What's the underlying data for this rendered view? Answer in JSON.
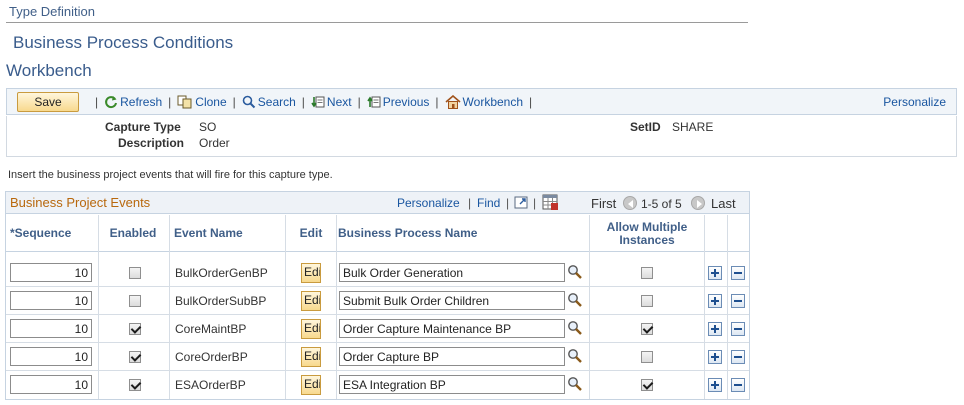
{
  "header": {
    "type_definition": "Type Definition",
    "title": "Business Process Conditions",
    "subtitle": "Workbench"
  },
  "toolbar": {
    "save_label": "Save",
    "refresh_label": "Refresh",
    "clone_label": "Clone",
    "search_label": "Search",
    "next_label": "Next",
    "previous_label": "Previous",
    "workbench_label": "Workbench",
    "separator": "|",
    "personalize_label": "Personalize"
  },
  "info": {
    "capture_type_label": "Capture Type",
    "capture_type_value": "SO",
    "description_label": "Description",
    "description_value": "Order",
    "setid_label": "SetID",
    "setid_value": "SHARE"
  },
  "instruction": "Insert the business project events that will fire for this capture type.",
  "grid": {
    "title": "Business Project Events",
    "personalize_label": "Personalize",
    "find_label": "Find",
    "first_label": "First",
    "range_label": "1-5 of 5",
    "last_label": "Last",
    "separator": "|",
    "columns": {
      "sequence": "*Sequence",
      "enabled": "Enabled",
      "event_name": "Event Name",
      "edit": "Edit",
      "bp_name": "Business Process Name",
      "allow_multiple": "Allow Multiple Instances"
    },
    "rows": [
      {
        "sequence": "10",
        "enabled": false,
        "event_name": "BulkOrderGenBP",
        "edit_label": "Edit",
        "bp_name": "Bulk Order Generation",
        "allow_multiple": false
      },
      {
        "sequence": "10",
        "enabled": false,
        "event_name": "BulkOrderSubBP",
        "edit_label": "Edit",
        "bp_name": "Submit Bulk Order Children",
        "allow_multiple": false
      },
      {
        "sequence": "10",
        "enabled": true,
        "event_name": "CoreMaintBP",
        "edit_label": "Edit",
        "bp_name": "Order Capture Maintenance BP",
        "allow_multiple": true
      },
      {
        "sequence": "10",
        "enabled": true,
        "event_name": "CoreOrderBP",
        "edit_label": "Edit",
        "bp_name": "Order Capture BP",
        "allow_multiple": false
      },
      {
        "sequence": "10",
        "enabled": true,
        "event_name": "ESAOrderBP",
        "edit_label": "Edit",
        "bp_name": "ESA Integration BP",
        "allow_multiple": true
      }
    ]
  },
  "icons": {
    "refresh": "refresh-icon",
    "clone": "clone-icon",
    "search": "search-icon",
    "next": "next-icon",
    "previous": "previous-icon",
    "workbench": "home-icon",
    "zoom": "view-all-icon",
    "download": "download-excel-icon",
    "lookup": "lookup-icon",
    "add_row": "add-row-icon",
    "delete_row": "delete-row-icon"
  },
  "colors": {
    "link": "#1a56a0",
    "title": "#3a5c8c",
    "grid_title": "#b8680d",
    "button_fill": "#f8d98e"
  }
}
